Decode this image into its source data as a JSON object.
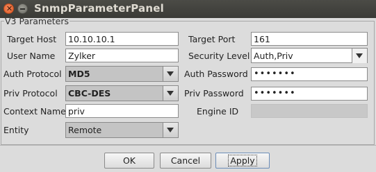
{
  "window": {
    "title": "SnmpParameterPanel",
    "close_symbol": "✕"
  },
  "group": {
    "legend": "V3 Parameters"
  },
  "fields": {
    "target_host": {
      "label": "Target Host",
      "value": "10.10.10.1"
    },
    "target_port": {
      "label": "Target Port",
      "value": "161"
    },
    "user_name": {
      "label": "User Name",
      "value": "Zylker"
    },
    "security_level": {
      "label": "Security Level",
      "value": "Auth,Priv"
    },
    "auth_protocol": {
      "label": "Auth Protocol",
      "value": "MD5"
    },
    "auth_password": {
      "label": "Auth Password",
      "value": "•••••••"
    },
    "priv_protocol": {
      "label": "Priv Protocol",
      "value": "CBC-DES"
    },
    "priv_password": {
      "label": "Priv Password",
      "value": "•••••••"
    },
    "context_name": {
      "label": "Context Name",
      "value": "priv"
    },
    "engine_id": {
      "label": "Engine ID",
      "value": ""
    },
    "entity": {
      "label": "Entity",
      "value": "Remote"
    }
  },
  "buttons": {
    "ok": "OK",
    "cancel": "Cancel",
    "apply": "Apply"
  }
}
